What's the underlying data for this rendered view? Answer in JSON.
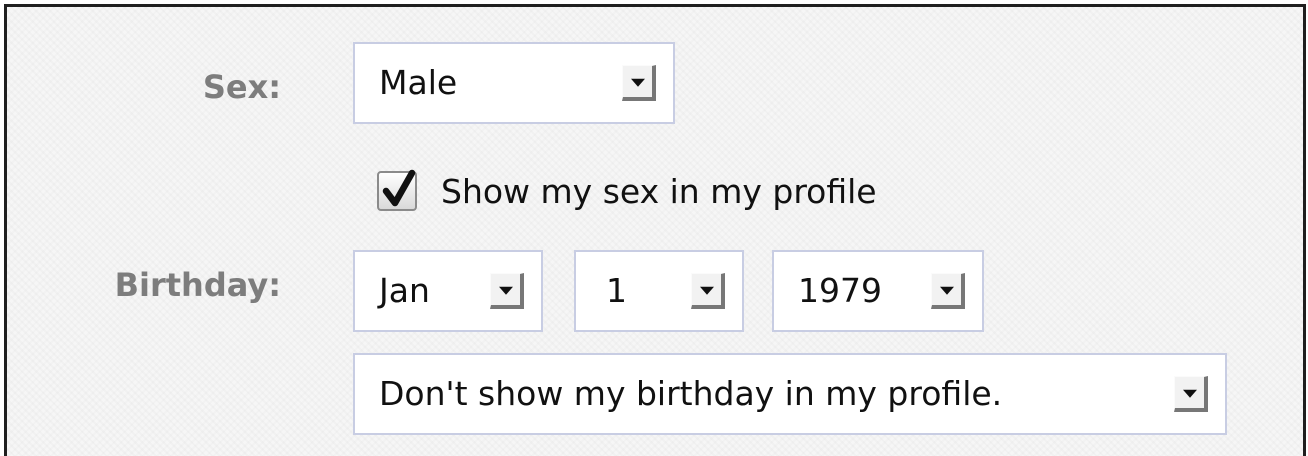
{
  "form": {
    "sex": {
      "label": "Sex:",
      "selected": "Male"
    },
    "show_sex": {
      "label": "Show my sex in my profile",
      "checked": true
    },
    "birthday": {
      "label": "Birthday:",
      "month": "Jan",
      "day": "1",
      "year": "1979",
      "visibility": "Don't show my birthday in my profile."
    }
  },
  "icons": {
    "dropdown": "chevron-down-icon",
    "check": "checkmark-icon"
  },
  "colors": {
    "border": "#1f1f1f",
    "label_text": "#7d7d7d",
    "select_border": "#c8cde3"
  }
}
